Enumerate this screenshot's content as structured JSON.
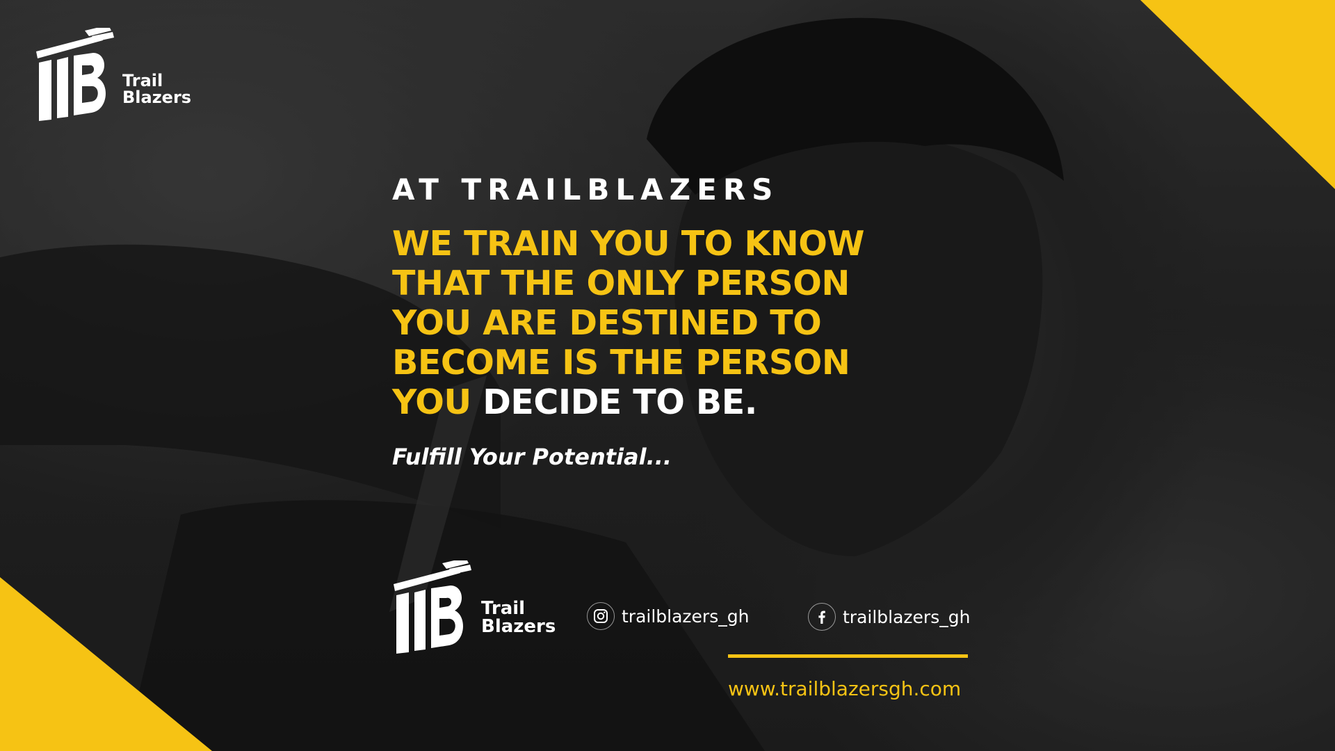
{
  "brand": {
    "name_line1": "Trail",
    "name_line2": "Blazers",
    "accent_color": "#f6c314",
    "text_color": "#ffffff"
  },
  "hero": {
    "kicker": "AT TRAILBLAZERS",
    "headline_lines": [
      "WE TRAIN YOU TO KNOW",
      "THAT THE ONLY PERSON",
      "YOU ARE DESTINED TO",
      "BECOME IS THE PERSON"
    ],
    "headline_last_prefix": "YOU ",
    "headline_last_emphasis": "DECIDE TO BE.",
    "tagline": "Fulfill Your Potential..."
  },
  "footer": {
    "instagram_handle": "trailblazers_gh",
    "instagram_icon": "instagram-icon",
    "facebook_handle": "trailblazers_gh",
    "facebook_icon": "facebook-icon",
    "website": "www.trailblazersgh.com"
  }
}
